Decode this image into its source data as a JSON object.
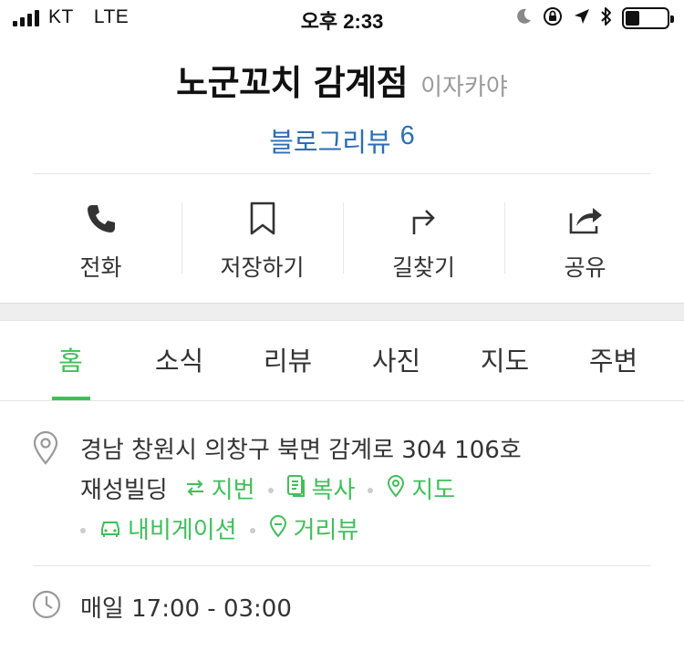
{
  "status_bar": {
    "carrier": "KT",
    "network": "LTE",
    "time": "오후 2:33",
    "battery_level": 0.35
  },
  "place": {
    "name": "노군꼬치 감계점",
    "category": "이자카야",
    "review_label": "블로그리뷰",
    "review_count": "6"
  },
  "actions": [
    {
      "label": "전화",
      "icon": "phone-icon"
    },
    {
      "label": "저장하기",
      "icon": "bookmark-icon"
    },
    {
      "label": "길찾기",
      "icon": "directions-icon"
    },
    {
      "label": "공유",
      "icon": "share-icon"
    }
  ],
  "tabs": [
    {
      "label": "홈",
      "active": true
    },
    {
      "label": "소식"
    },
    {
      "label": "리뷰"
    },
    {
      "label": "사진"
    },
    {
      "label": "지도"
    },
    {
      "label": "주변"
    }
  ],
  "address": {
    "line1": "경남 창원시 의창구 북면 감계로 304 106호",
    "line2": "재성빌딩",
    "lot_number_label": "지번",
    "copy_label": "복사",
    "map_label": "지도",
    "navigation_label": "내비게이션",
    "street_view_label": "거리뷰"
  },
  "hours": {
    "text": "매일 17:00 - 03:00"
  },
  "colors": {
    "accent_green": "#3fbf5a",
    "link_blue": "#2d6db5"
  }
}
